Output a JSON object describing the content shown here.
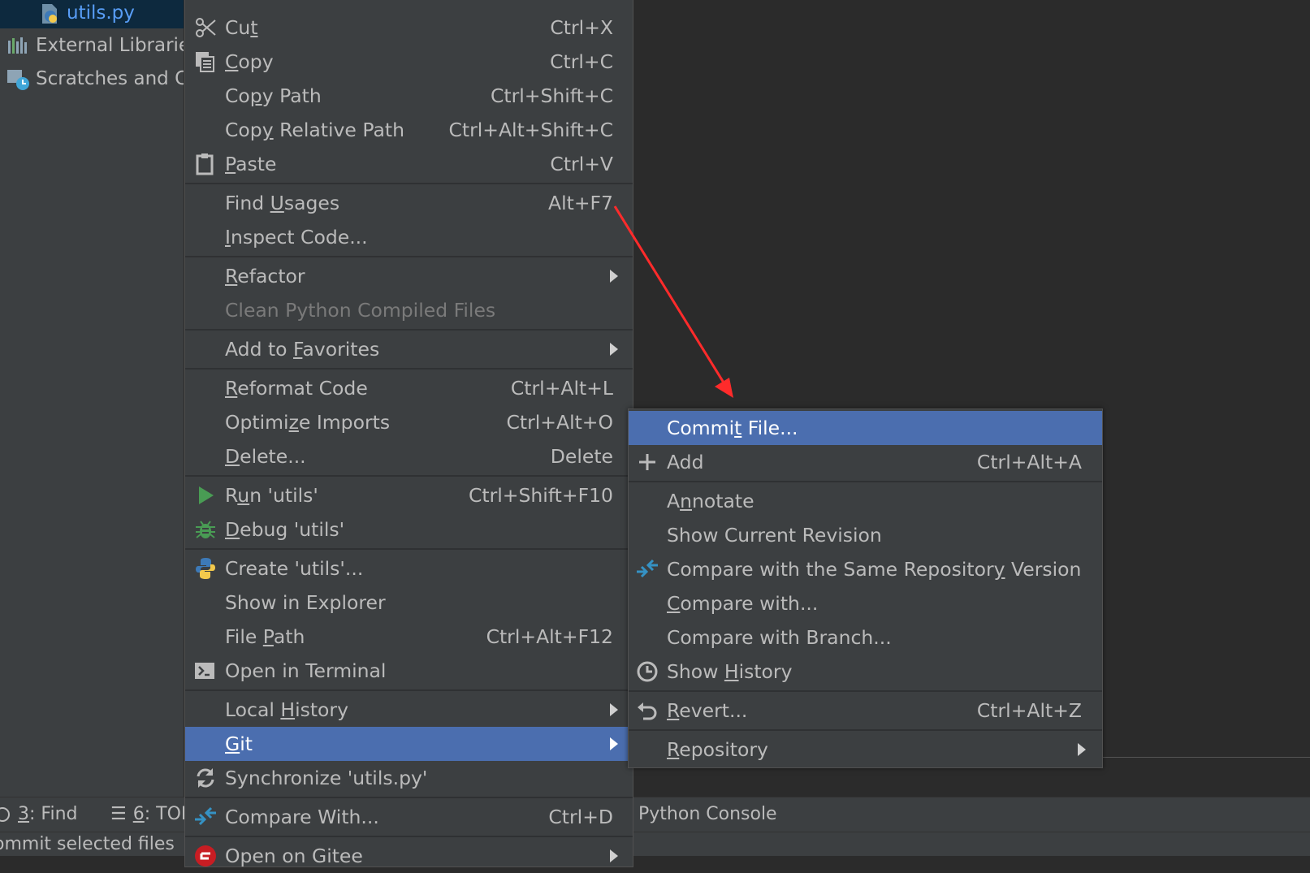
{
  "colors": {
    "panel": "#3c3f41",
    "editor": "#2b2b2b",
    "selection": "#4b6eaf",
    "tree_selection": "#0d293e",
    "annotation_arrow": "#ff2b2b"
  },
  "tree": {
    "items": [
      {
        "label": "utils.py",
        "icon": "python-file-icon"
      },
      {
        "label": "External Librarie",
        "icon": "libraries-icon"
      },
      {
        "label": "Scratches and C",
        "icon": "scratches-icon"
      }
    ]
  },
  "bottom_bar": {
    "find_num": "3",
    "find_label": ": Find",
    "todo_num": "6",
    "todo_label": ": TOI",
    "python_console": "Python Console"
  },
  "status_bar": {
    "text": "ommit selected files"
  },
  "context_menu": {
    "cut": {
      "pre": "Cu",
      "mn": "t",
      "post": "",
      "shortcut": "Ctrl+X"
    },
    "copy": {
      "pre": "",
      "mn": "C",
      "post": "opy",
      "shortcut": "Ctrl+C"
    },
    "copy_path": {
      "pre": "Co",
      "mn": "p",
      "post": "y Path",
      "shortcut": "Ctrl+Shift+C"
    },
    "copy_relative_path": {
      "pre": "Cop",
      "mn": "y",
      "post": " Relative Path",
      "shortcut": "Ctrl+Alt+Shift+C"
    },
    "paste": {
      "pre": "",
      "mn": "P",
      "post": "aste",
      "shortcut": "Ctrl+V"
    },
    "find_usages": {
      "pre": "Find ",
      "mn": "U",
      "post": "sages",
      "shortcut": "Alt+F7"
    },
    "inspect_code": {
      "pre": "",
      "mn": "I",
      "post": "nspect Code..."
    },
    "refactor": {
      "pre": "",
      "mn": "R",
      "post": "efactor"
    },
    "clean_python": {
      "label": "Clean Python Compiled Files"
    },
    "add_to_favorites": {
      "pre": "Add to ",
      "mn": "F",
      "post": "avorites"
    },
    "reformat_code": {
      "pre": "",
      "mn": "R",
      "post": "eformat Code",
      "shortcut": "Ctrl+Alt+L"
    },
    "optimize_imports": {
      "pre": "Optimi",
      "mn": "z",
      "post": "e Imports",
      "shortcut": "Ctrl+Alt+O"
    },
    "delete": {
      "pre": "",
      "mn": "D",
      "post": "elete...",
      "shortcut": "Delete"
    },
    "run": {
      "pre": "R",
      "mn": "u",
      "post": "n 'utils'",
      "shortcut": "Ctrl+Shift+F10"
    },
    "debug": {
      "pre": "",
      "mn": "D",
      "post": "ebug 'utils'"
    },
    "create": {
      "label": "Create 'utils'..."
    },
    "show_in_explorer": {
      "label": "Show in Explorer"
    },
    "file_path": {
      "pre": "File ",
      "mn": "P",
      "post": "ath",
      "shortcut": "Ctrl+Alt+F12"
    },
    "open_in_terminal": {
      "label": "Open in Terminal"
    },
    "local_history": {
      "pre": "Local ",
      "mn": "H",
      "post": "istory"
    },
    "git": {
      "pre": "",
      "mn": "G",
      "post": "it"
    },
    "synchronize": {
      "label": "Synchronize 'utils.py'"
    },
    "compare_with": {
      "label": "Compare With...",
      "shortcut": "Ctrl+D"
    },
    "open_on_gitee": {
      "label": "Open on Gitee"
    }
  },
  "git_submenu": {
    "commit_file": {
      "pre": "Commi",
      "mn": "t",
      "post": " File..."
    },
    "add": {
      "label": "Add",
      "shortcut": "Ctrl+Alt+A"
    },
    "annotate": {
      "pre": "A",
      "mn": "n",
      "post": "notate"
    },
    "show_current_revision": {
      "label": "Show Current Revision"
    },
    "compare_same_repo": {
      "pre": "Compare with the Same Repositor",
      "mn": "y",
      "post": " Version"
    },
    "compare_with": {
      "pre": "",
      "mn": "C",
      "post": "ompare with..."
    },
    "compare_with_branch": {
      "label": "Compare with Branch..."
    },
    "show_history": {
      "pre": "Show ",
      "mn": "H",
      "post": "istory"
    },
    "revert": {
      "pre": "",
      "mn": "R",
      "post": "evert...",
      "shortcut": "Ctrl+Alt+Z"
    },
    "repository": {
      "pre": "",
      "mn": "R",
      "post": "epository"
    }
  }
}
